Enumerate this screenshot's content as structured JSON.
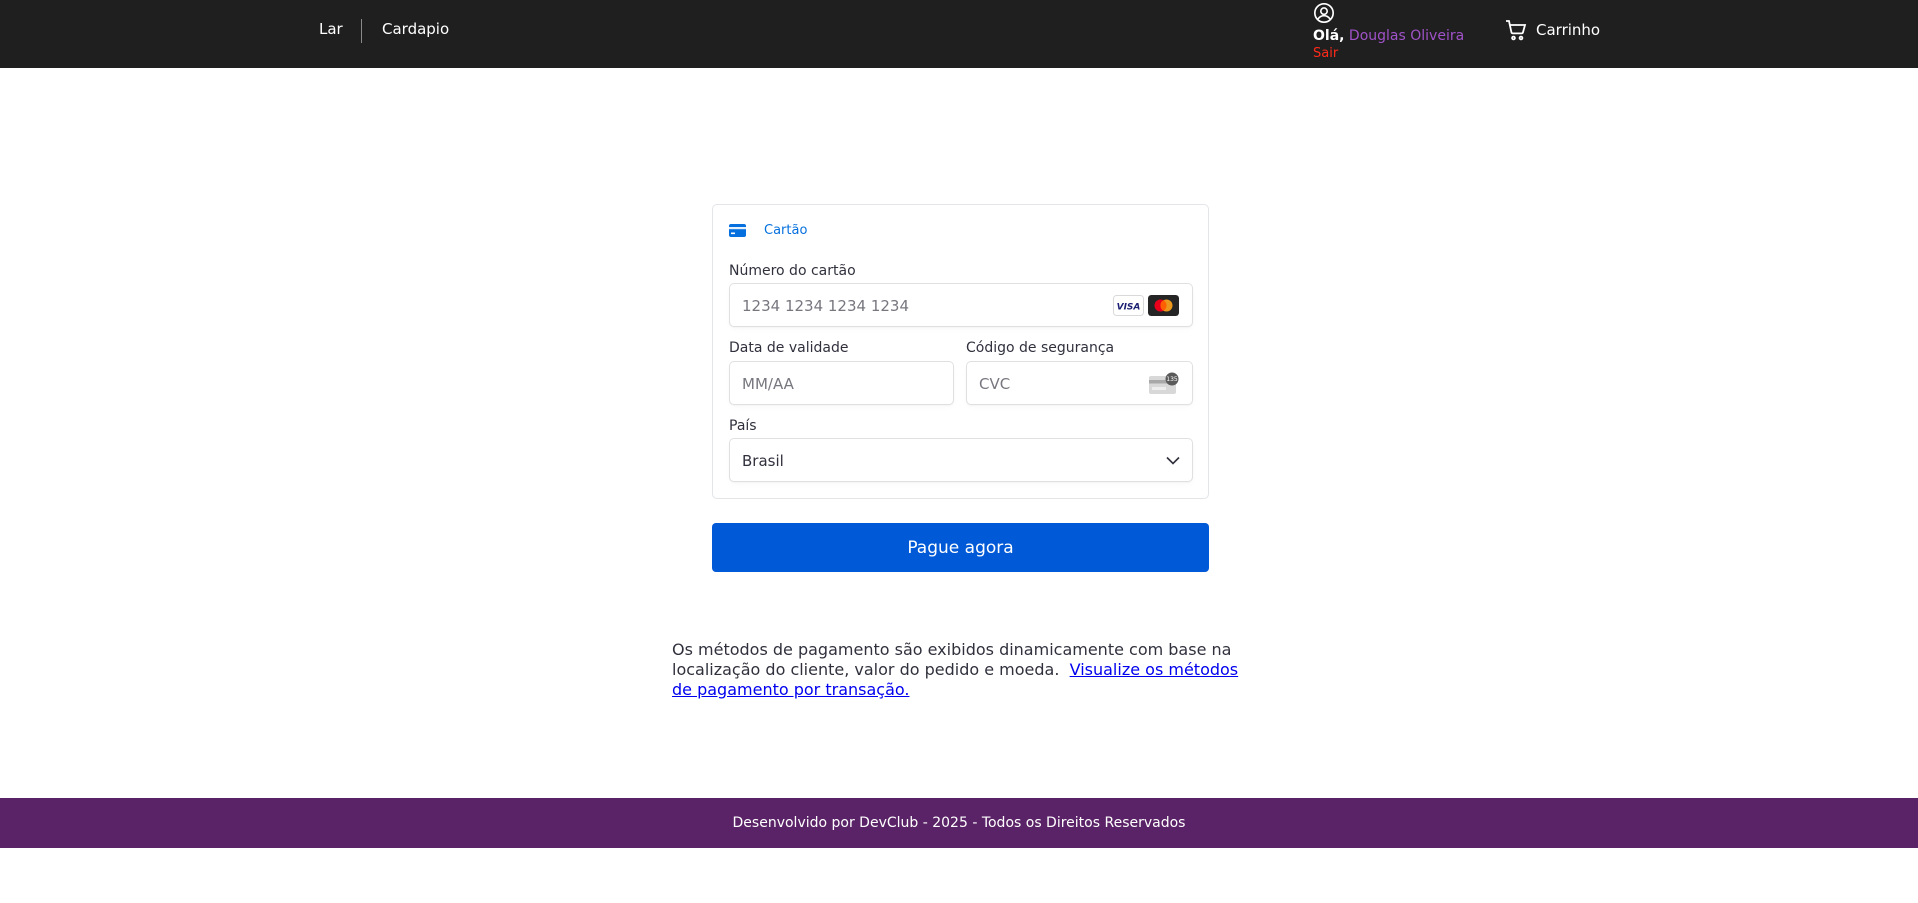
{
  "header": {
    "nav": [
      {
        "label": "Lar"
      },
      {
        "label": "Cardapio"
      }
    ],
    "user": {
      "greeting": "Olá,",
      "name": "Douglas Oliveira",
      "logout_label": "Sair",
      "icon": "user-circle-icon"
    },
    "cart": {
      "label": "Carrinho",
      "icon": "shopping-cart-icon"
    }
  },
  "payment": {
    "tab": {
      "label": "Cartão",
      "icon": "credit-card-icon"
    },
    "card_number": {
      "label": "Número do cartão",
      "placeholder": "1234 1234 1234 1234",
      "brands": [
        "VISA",
        "mastercard"
      ]
    },
    "expiry": {
      "label": "Data de validade",
      "placeholder": "MM/AA"
    },
    "cvc": {
      "label": "Código de segurança",
      "placeholder": "CVC",
      "badge": "135"
    },
    "country": {
      "label": "País",
      "value": "Brasil"
    }
  },
  "pay_button": {
    "label": "Pague agora"
  },
  "info": {
    "text": "Os métodos de pagamento são exibidos dinamicamente com base na localização do cliente, valor do pedido e moeda.",
    "link": "Visualize os métodos de pagamento por transação."
  },
  "footer": {
    "text": "Desenvolvido por DevClub - 2025 - Todos os Direitos Reservados"
  },
  "colors": {
    "header_bg": "#1f1f1f",
    "footer_bg": "#5b2367",
    "accent_blue": "#0059d6",
    "user_name": "#a052c9",
    "logout": "#ff2a1a"
  }
}
